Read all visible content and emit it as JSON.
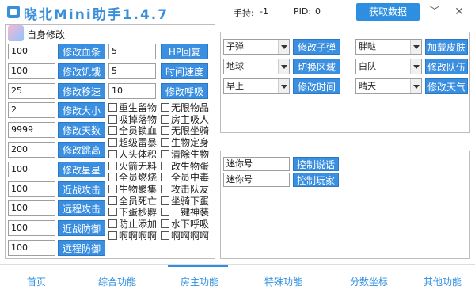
{
  "app": {
    "title": "晓北Mini助手1.4.7",
    "status_hold_label": "手持:",
    "status_hold_value": "-1",
    "status_pid_label": "PID:",
    "status_pid_value": "0",
    "fetch_button": "获取数据",
    "minimize_glyph": "﹀",
    "close_glyph": "✕"
  },
  "self_panel": {
    "title": "自身修改",
    "rows_left": [
      {
        "value": "100",
        "button": "修改血条"
      },
      {
        "value": "100",
        "button": "修改饥饿"
      },
      {
        "value": "25",
        "button": "修改移速"
      },
      {
        "value": "2",
        "button": "修改大小"
      },
      {
        "value": "9999",
        "button": "修改天数"
      },
      {
        "value": "200",
        "button": "修改跳高"
      },
      {
        "value": "100",
        "button": "修改星星"
      },
      {
        "value": "100",
        "button": "近战攻击"
      },
      {
        "value": "100",
        "button": "远程攻击"
      },
      {
        "value": "100",
        "button": "近战防御"
      },
      {
        "value": "100",
        "button": "远程防御"
      }
    ],
    "rows_mid": [
      {
        "value": "5",
        "button": "HP回复"
      },
      {
        "value": "5",
        "button": "时间速度"
      },
      {
        "value": "10",
        "button": "修改呼吸"
      }
    ],
    "checkboxes_col1": [
      "重生留物",
      "吸掉落物",
      "全员锁血",
      "超级雷暴",
      "人头体积",
      "火箭无料",
      "全员燃烧",
      "生物聚集",
      "全员死亡",
      "下蛋秒孵",
      "防止添加",
      "啊啊啊啊"
    ],
    "checkboxes_col2": [
      "无限物品",
      "房主吸人",
      "无限坐骑",
      "生物定身",
      "清除生物",
      "改生物蛋",
      "全员中毒",
      "攻击队友",
      "坐骑下蛋",
      "一键神装",
      "水下呼吸",
      "啊啊啊啊"
    ]
  },
  "world_panel": {
    "selects": [
      {
        "value": "子弹",
        "button": "修改子弹"
      },
      {
        "value": "地球",
        "button": "切换区域"
      },
      {
        "value": "早上",
        "button": "修改时间"
      }
    ],
    "selects_right": [
      {
        "value": "胖哒",
        "button": "加载皮肤"
      },
      {
        "value": "白队",
        "button": "修改队伍"
      },
      {
        "value": "晴天",
        "button": "修改天气"
      }
    ]
  },
  "control_panel": {
    "rows": [
      {
        "value": "迷你号",
        "button": "控制说话"
      },
      {
        "value": "迷你号",
        "button": "控制玩家"
      }
    ]
  },
  "tabs": [
    {
      "label": "首页"
    },
    {
      "label": "综合功能"
    },
    {
      "label": "房主功能"
    },
    {
      "label": "特殊功能"
    },
    {
      "label": "分数坐标"
    },
    {
      "label": "其他功能"
    }
  ],
  "active_tab": "房主功能",
  "colors": {
    "accent": "#2e8fe0",
    "button": "#3b8fe0"
  }
}
